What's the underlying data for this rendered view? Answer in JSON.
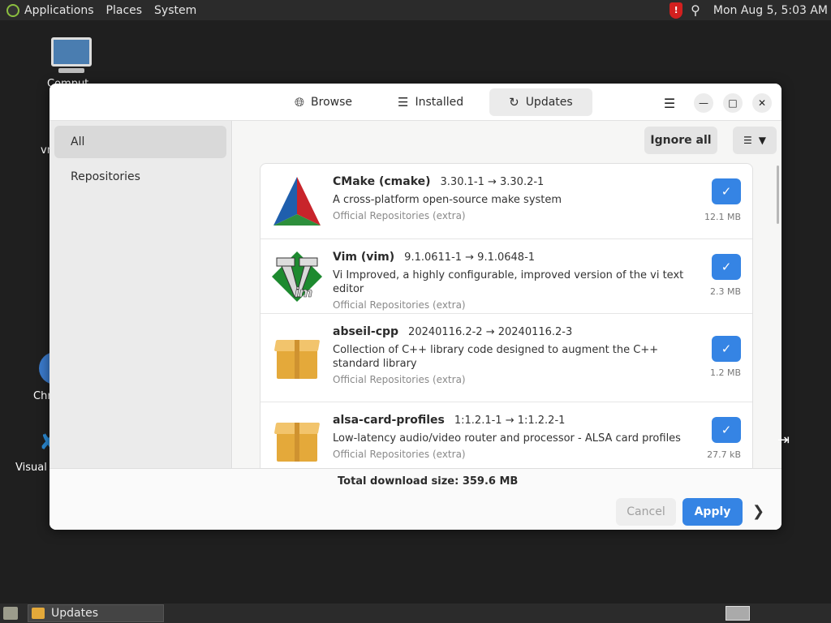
{
  "top_panel": {
    "menus": [
      "Applications",
      "Places",
      "System"
    ],
    "shield_glyph": "!",
    "clock": "Mon Aug  5,  5:03 AM"
  },
  "desktop": {
    "icons": [
      {
        "label": "Comput",
        "icon": "computer-icon"
      },
      {
        "label": "vm",
        "icon": "folder-icon"
      },
      {
        "label": "Chr",
        "icon": "chrome-icon"
      },
      {
        "label": "Visual S",
        "icon": "vscode-icon"
      }
    ]
  },
  "window": {
    "tabs": [
      {
        "label": "Browse",
        "icon": "globe-icon"
      },
      {
        "label": "Installed",
        "icon": "list-icon"
      },
      {
        "label": "Updates",
        "icon": "refresh-icon",
        "active": true
      }
    ],
    "sidebar": [
      {
        "label": "All",
        "active": true
      },
      {
        "label": "Repositories"
      }
    ],
    "toolbar": {
      "ignore_all": "Ignore all"
    },
    "packages": [
      {
        "name": "CMake (cmake)",
        "version": "3.30.1-1 → 3.30.2-1",
        "description": "A cross-platform open-source make system",
        "source": "Official Repositories (extra)",
        "size": "12.1 MB",
        "icon": "cmake-icon",
        "checked": true
      },
      {
        "name": "Vim (vim)",
        "version": "9.1.0611-1 → 9.1.0648-1",
        "description": "Vi Improved, a highly configurable, improved version of the vi text editor",
        "source": "Official Repositories (extra)",
        "size": "2.3 MB",
        "icon": "vim-icon",
        "checked": true
      },
      {
        "name": "abseil-cpp",
        "version": "20240116.2-2 → 20240116.2-3",
        "description": "Collection of C++ library code designed to augment the C++ standard library",
        "source": "Official Repositories (extra)",
        "size": "1.2 MB",
        "icon": "package-box-icon",
        "checked": true
      },
      {
        "name": "alsa-card-profiles",
        "version": "1:1.2.1-1 → 1:1.2.2-1",
        "description": "Low-latency audio/video router and processor - ALSA card profiles",
        "source": "Official Repositories (extra)",
        "size": "27.7 kB",
        "icon": "package-box-icon",
        "checked": true
      }
    ],
    "footer": {
      "total": "Total download size: 359.6 MB",
      "cancel": "Cancel",
      "apply": "Apply"
    }
  },
  "taskbar": {
    "task_label": "Updates"
  },
  "colors": {
    "accent": "#3584e4",
    "panel": "#2b2b2b"
  }
}
